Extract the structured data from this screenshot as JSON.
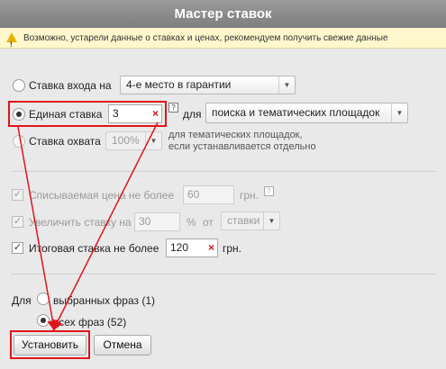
{
  "window": {
    "title": "Мастер ставок"
  },
  "warning": {
    "icon": "warning-icon",
    "text": "Возможно, устарели данные о ставках и ценах, рекомендуем получить свежие данные"
  },
  "bid_modes": {
    "entry": {
      "label": "Ставка входа на",
      "select_value": "4-е место в гарантии"
    },
    "single": {
      "label": "Единая ставка",
      "value": "3",
      "for_label": "для",
      "select_value": "поиска и тематических площадок",
      "help": "?"
    },
    "coverage": {
      "label": "Ставка охвата",
      "select_value": "100%",
      "note_line1": "для тематических площадок,",
      "note_line2": "если устанавливается отдельно"
    }
  },
  "limits": {
    "max_price": {
      "label": "Списываемая цена не более",
      "value": "60",
      "unit": "грн.",
      "help": "?"
    },
    "increase": {
      "label": "Увеличить ставку на",
      "value": "30",
      "unit": "%",
      "from_label": "от",
      "select_value": "ставки"
    },
    "final_bid": {
      "label": "Итоговая ставка не более",
      "value": "120",
      "unit": "грн."
    }
  },
  "scope": {
    "for_label": "Для",
    "selected": "выбранных фраз (1)",
    "all": "всех фраз (52)"
  },
  "buttons": {
    "apply": "Установить",
    "cancel": "Отмена"
  },
  "colors": {
    "highlight": "#e0151c",
    "titlebar": "#8a8a8a",
    "warning_bg": "#fff8cc"
  }
}
